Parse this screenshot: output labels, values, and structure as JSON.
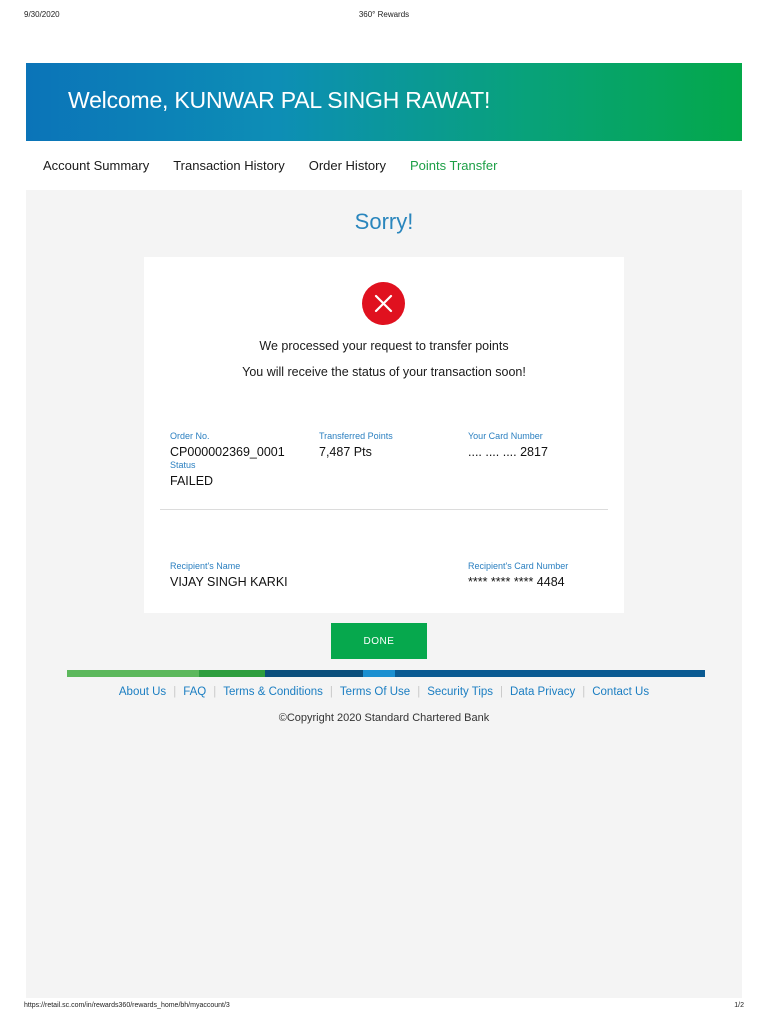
{
  "print": {
    "date": "9/30/2020",
    "title": "360° Rewards",
    "url": "https://retail.sc.com/in/rewards360/rewards_home/bh/myaccount/3",
    "page": "1/2"
  },
  "hero": {
    "welcome": "Welcome, KUNWAR PAL SINGH RAWAT!"
  },
  "tabs": [
    {
      "label": "Account Summary",
      "active": false
    },
    {
      "label": "Transaction History",
      "active": false
    },
    {
      "label": "Order History",
      "active": false
    },
    {
      "label": "Points Transfer",
      "active": true
    }
  ],
  "result": {
    "heading": "Sorry!",
    "icon": "close-icon",
    "line1": "We processed your request to transfer points",
    "line2": "You will receive the status of your transaction soon!"
  },
  "details": {
    "order_no_label": "Order No.",
    "order_no": "CP000002369_0001",
    "points_label": "Transferred Points",
    "points": "7,487 Pts",
    "card_label": "Your Card Number",
    "card": ".... .... .... 2817",
    "status_label": "Status",
    "status": "FAILED",
    "recipient_name_label": "Recipient's Name",
    "recipient_name": "VIJAY SINGH KARKI",
    "recipient_card_label": "Recipient's Card Number",
    "recipient_card": "**** **** **** 4484"
  },
  "done_label": "DONE",
  "footer": {
    "links": [
      "About Us",
      "FAQ",
      "Terms & Conditions",
      "Terms Of Use",
      "Security Tips",
      "Data Privacy",
      "Contact Us"
    ],
    "copyright": "©Copyright 2020 Standard Chartered Bank"
  },
  "colors": {
    "accent_green": "#06a84d",
    "accent_blue": "#2a86bd",
    "error_red": "#e0111f",
    "stripe": [
      "#5cb85c",
      "#2e9e3e",
      "#0b4f7c",
      "#1b8fd0",
      "#0a5a92"
    ]
  }
}
